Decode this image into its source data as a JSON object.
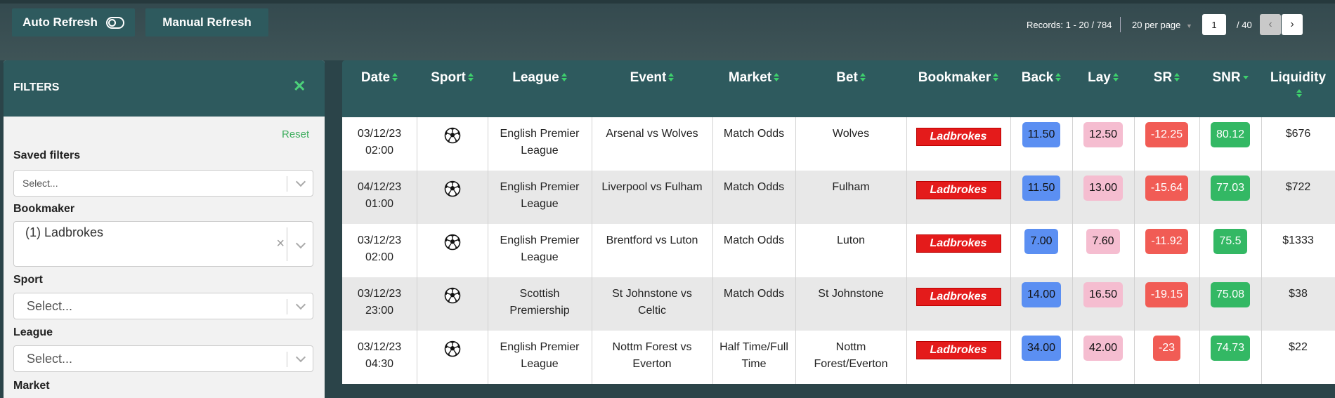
{
  "toolbar": {
    "auto_refresh_label": "Auto Refresh",
    "manual_refresh_label": "Manual Refresh",
    "records_text": "Records: 1 - 20 / 784",
    "per_page": "20 per page",
    "current_page": "1",
    "total_pages": "/ 40",
    "prev_label": "‹",
    "next_label": "›"
  },
  "filters": {
    "title": "FILTERS",
    "close_label": "✕",
    "reset_label": "Reset",
    "saved_filters": {
      "label": "Saved filters",
      "placeholder": "Select..."
    },
    "bookmaker": {
      "label": "Bookmaker",
      "value": "(1) Ladbrokes",
      "clear": "×"
    },
    "sport": {
      "label": "Sport",
      "placeholder": "Select..."
    },
    "league": {
      "label": "League",
      "placeholder": "Select..."
    },
    "market": {
      "label": "Market"
    }
  },
  "table": {
    "columns": [
      "Date",
      "Sport",
      "League",
      "Event",
      "Market",
      "Bet",
      "Bookmaker",
      "Back",
      "Lay",
      "SR",
      "SNR",
      "Liquidity"
    ],
    "rows": [
      {
        "date": "03/12/23",
        "time": "02:00",
        "sport_icon": "soccer-ball-icon",
        "league": "English Premier League",
        "event": "Arsenal vs Wolves",
        "market": "Match Odds",
        "bet": "Wolves",
        "bookmaker": "Ladbrokes",
        "back": "11.50",
        "lay": "12.50",
        "sr": "-12.25",
        "snr": "80.12",
        "liquidity": "$676"
      },
      {
        "date": "04/12/23",
        "time": "01:00",
        "sport_icon": "soccer-ball-icon",
        "league": "English Premier League",
        "event": "Liverpool vs Fulham",
        "market": "Match Odds",
        "bet": "Fulham",
        "bookmaker": "Ladbrokes",
        "back": "11.50",
        "lay": "13.00",
        "sr": "-15.64",
        "snr": "77.03",
        "liquidity": "$722"
      },
      {
        "date": "03/12/23",
        "time": "02:00",
        "sport_icon": "soccer-ball-icon",
        "league": "English Premier League",
        "event": "Brentford vs Luton",
        "market": "Match Odds",
        "bet": "Luton",
        "bookmaker": "Ladbrokes",
        "back": "7.00",
        "lay": "7.60",
        "sr": "-11.92",
        "snr": "75.5",
        "liquidity": "$1333"
      },
      {
        "date": "03/12/23",
        "time": "23:00",
        "sport_icon": "soccer-ball-icon",
        "league": "Scottish Premiership",
        "event": "St Johnstone vs Celtic",
        "market": "Match Odds",
        "bet": "St Johnstone",
        "bookmaker": "Ladbrokes",
        "back": "14.00",
        "lay": "16.50",
        "sr": "-19.15",
        "snr": "75.08",
        "liquidity": "$38"
      },
      {
        "date": "03/12/23",
        "time": "04:30",
        "sport_icon": "soccer-ball-icon",
        "league": "English Premier League",
        "event": "Nottm Forest vs Everton",
        "market": "Half Time/Full Time",
        "bet": "Nottm Forest/Everton",
        "bookmaker": "Ladbrokes",
        "back": "34.00",
        "lay": "42.00",
        "sr": "-23",
        "snr": "74.73",
        "liquidity": "$22"
      }
    ]
  },
  "colors": {
    "header": "#2e5a5e",
    "accent": "#3ed06d",
    "bookmaker": "#e41b1b",
    "back": "#5b8ff2",
    "lay": "#f5bdd0",
    "sr": "#f15c55",
    "snr": "#33b864"
  }
}
